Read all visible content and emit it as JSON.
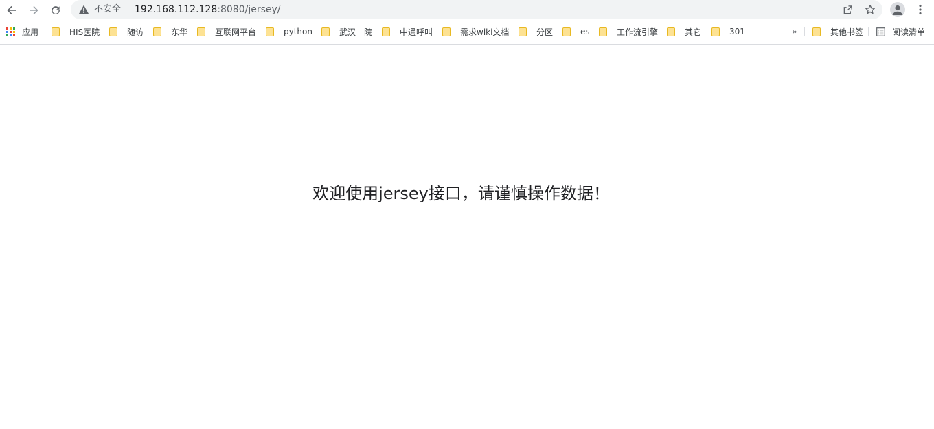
{
  "toolbar": {
    "back_icon": "back-arrow-icon",
    "forward_icon": "forward-arrow-icon",
    "reload_icon": "reload-icon",
    "security_label": "不安全",
    "url_host": "192.168.112.128",
    "url_rest": ":8080/jersey/",
    "share_icon": "share-icon",
    "star_icon": "star-icon",
    "profile_icon": "profile-icon",
    "menu_icon": "more-vert-icon"
  },
  "bookmarks": {
    "apps_label": "应用",
    "items": [
      {
        "label": "HIS医院"
      },
      {
        "label": "随访"
      },
      {
        "label": "东华"
      },
      {
        "label": "互联网平台"
      },
      {
        "label": "python"
      },
      {
        "label": "武汉一院"
      },
      {
        "label": "中通呼叫"
      },
      {
        "label": "需求wiki文档"
      },
      {
        "label": "分区"
      },
      {
        "label": "es"
      },
      {
        "label": "工作流引擎"
      },
      {
        "label": "其它"
      },
      {
        "label": "301"
      }
    ],
    "overflow_label": "»",
    "other_bookmarks_label": "其他书签",
    "reading_list_label": "阅读清单"
  },
  "page": {
    "message": "欢迎使用jersey接口，请谨慎操作数据！"
  }
}
